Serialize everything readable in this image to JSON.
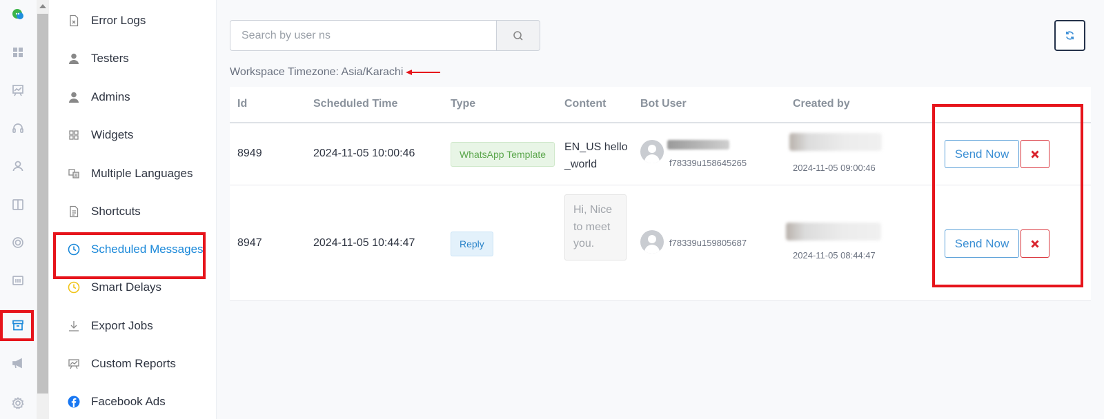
{
  "rail_icons": [
    "chat-logo-icon",
    "dashboard-icon",
    "analytics-icon",
    "support-headset-icon",
    "user-icon",
    "layout-icon",
    "help-ring-icon",
    "reports-icon",
    "archive-icon",
    "megaphone-icon",
    "gear-icon"
  ],
  "nav": {
    "items": [
      {
        "label": "Error Logs",
        "icon": "file-x-icon"
      },
      {
        "label": "Testers",
        "icon": "person-icon"
      },
      {
        "label": "Admins",
        "icon": "person-icon"
      },
      {
        "label": "Widgets",
        "icon": "widgets-icon"
      },
      {
        "label": "Multiple Languages",
        "icon": "translate-icon"
      },
      {
        "label": "Shortcuts",
        "icon": "document-icon"
      },
      {
        "label": "Scheduled Messages",
        "icon": "clock-icon",
        "active": true
      },
      {
        "label": "Smart Delays",
        "icon": "clock-yellow-icon"
      },
      {
        "label": "Export Jobs",
        "icon": "download-icon"
      },
      {
        "label": "Custom Reports",
        "icon": "presentation-icon"
      },
      {
        "label": "Facebook Ads",
        "icon": "facebook-icon"
      }
    ]
  },
  "search": {
    "placeholder": "Search by user ns",
    "value": ""
  },
  "timezone": {
    "label": "Workspace Timezone: Asia/Karachi"
  },
  "table": {
    "headers": [
      "Id",
      "Scheduled Time",
      "Type",
      "Content",
      "Bot User",
      "Created by"
    ],
    "rows": [
      {
        "id": "8949",
        "scheduled_time": "2024-11-05 10:00:46",
        "type": "WhatsApp Template",
        "content": "EN_US hello _world",
        "bot_user_ns": "f78339u158645265",
        "created_at": "2024-11-05 09:00:46",
        "send_label": "Send Now"
      },
      {
        "id": "8947",
        "scheduled_time": "2024-11-05 10:44:47",
        "type": "Reply",
        "content": "Hi, Nice to meet you.",
        "bot_user_ns": "f78339u159805687",
        "created_at": "2024-11-05 08:44:47",
        "send_label": "Send Now"
      }
    ]
  },
  "colors": {
    "accent": "#1a88d9",
    "highlight": "#e6141b",
    "success": "#5aa64b"
  }
}
